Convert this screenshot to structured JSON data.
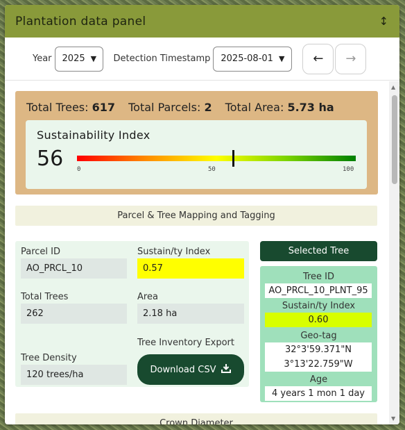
{
  "header": {
    "title": "Plantation data panel",
    "resize_icon": "↕"
  },
  "controls": {
    "year_label": "Year",
    "year_value": "2025",
    "timestamp_label": "Detection Timestamp",
    "timestamp_value": "2025-08-01",
    "prev_icon": "←",
    "next_icon": "→"
  },
  "summary": {
    "total_trees_label": "Total Trees:",
    "total_trees": "617",
    "total_parcels_label": "Total Parcels:",
    "total_parcels": "2",
    "total_area_label": "Total Area:",
    "total_area": "5.73 ha"
  },
  "sustainability": {
    "title": "Sustainability Index",
    "value": "56",
    "level": 56,
    "scale_min": "0",
    "scale_mid": "50",
    "scale_max": "100"
  },
  "mapping_section": {
    "label": "Parcel & Tree Mapping and Tagging"
  },
  "parcel": {
    "parcel_id_label": "Parcel ID",
    "parcel_id": "AO_PRCL_10",
    "sustain_label": "Sustain/ty Index",
    "sustain_value": "0.57",
    "total_trees_label": "Total Trees",
    "total_trees": "262",
    "area_label": "Area",
    "area": "2.18 ha",
    "inventory_label": "Tree Inventory Export",
    "tree_density_label": "Tree Density",
    "tree_density": "120 trees/ha",
    "download_label": "Download CSV",
    "download_icon": "download-icon"
  },
  "selected_tree": {
    "button_label": "Selected Tree",
    "tree_id_label": "Tree ID",
    "tree_id": "AO_PRCL_10_PLNT_95",
    "sustain_label": "Sustain/ty Index",
    "sustain_value": "0.60",
    "geotag_label": "Geo-tag",
    "geotag_lat": "32°3'59.371\"N",
    "geotag_lon": "3°13'22.759\"W",
    "age_label": "Age",
    "age": "4 years 1 mon 1 day"
  },
  "crown_section": {
    "label": "Crown Diameter"
  },
  "colors": {
    "header": "#899a3a",
    "summary_bg": "#ddb784",
    "dark_green": "#184a2f",
    "highlight_yellow": "#ffff00",
    "tree_card": "#9fe0bb"
  }
}
